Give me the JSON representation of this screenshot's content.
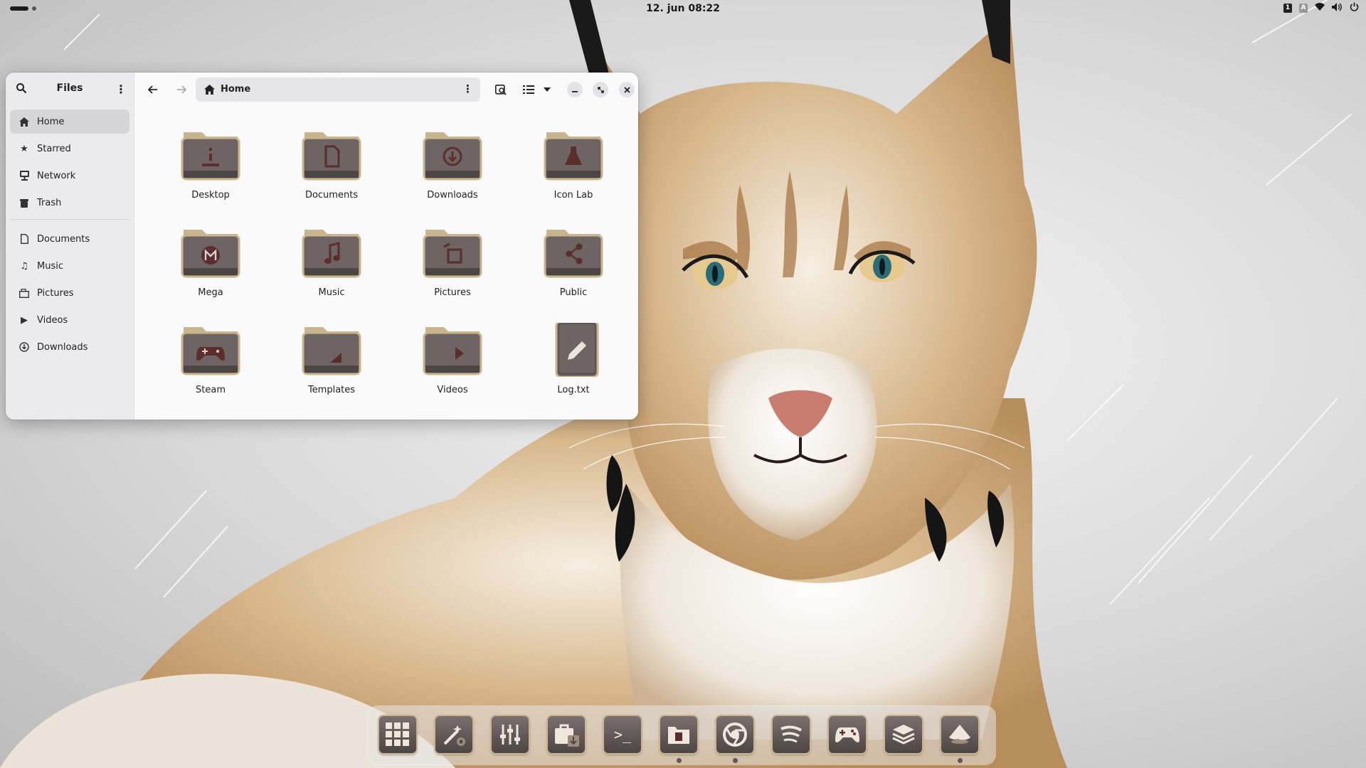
{
  "topbar": {
    "clock": "12. jun  08:22",
    "tray": {
      "kbd1": "1",
      "kbd2": "A"
    }
  },
  "window": {
    "sidebar_title": "Files",
    "sidebar_places": [
      {
        "label": "Home",
        "icon": "home-icon",
        "active": true
      },
      {
        "label": "Starred",
        "icon": "star-icon"
      },
      {
        "label": "Network",
        "icon": "network-icon"
      },
      {
        "label": "Trash",
        "icon": "trash-icon"
      }
    ],
    "sidebar_bookmarks": [
      {
        "label": "Documents",
        "icon": "document-icon"
      },
      {
        "label": "Music",
        "icon": "music-icon"
      },
      {
        "label": "Pictures",
        "icon": "pictures-icon"
      },
      {
        "label": "Videos",
        "icon": "play-icon"
      },
      {
        "label": "Downloads",
        "icon": "download-icon"
      }
    ],
    "path_label": "Home",
    "items": [
      {
        "label": "Desktop",
        "emblem": "desktop"
      },
      {
        "label": "Documents",
        "emblem": "document"
      },
      {
        "label": "Downloads",
        "emblem": "download"
      },
      {
        "label": "Icon Lab",
        "emblem": "flask"
      },
      {
        "label": "Mega",
        "emblem": "mega"
      },
      {
        "label": "Music",
        "emblem": "music"
      },
      {
        "label": "Pictures",
        "emblem": "pictures"
      },
      {
        "label": "Public",
        "emblem": "share"
      },
      {
        "label": "Steam",
        "emblem": "gamepad"
      },
      {
        "label": "Templates",
        "emblem": "template"
      },
      {
        "label": "Videos",
        "emblem": "play"
      },
      {
        "label": "Log.txt",
        "emblem": "text-file"
      }
    ]
  },
  "dock": {
    "apps": [
      {
        "name": "app-grid-icon",
        "running": false
      },
      {
        "name": "magic-wand-settings-icon",
        "running": false
      },
      {
        "name": "mixer-sliders-icon",
        "running": false
      },
      {
        "name": "software-store-icon",
        "running": false
      },
      {
        "name": "terminal-icon",
        "running": false
      },
      {
        "name": "files-icon",
        "running": true
      },
      {
        "name": "chrome-browser-icon",
        "running": true
      },
      {
        "name": "spotify-icon",
        "running": false
      },
      {
        "name": "gamepad-icon",
        "running": false
      },
      {
        "name": "layers-icon",
        "running": false
      },
      {
        "name": "inkscape-icon",
        "running": true
      }
    ],
    "terminal_glyph": ">_"
  },
  "colors": {
    "folder_tan": "#c8b58e",
    "folder_body": "#6e6464",
    "accent_brown": "#5b3a3a"
  }
}
